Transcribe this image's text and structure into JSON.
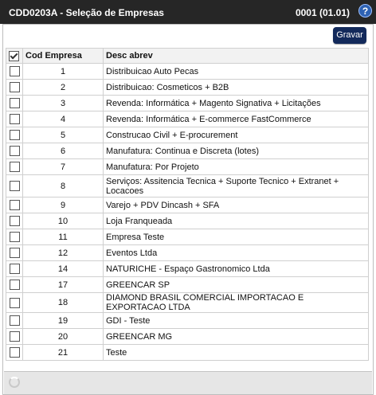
{
  "window": {
    "title": "CDD0203A - Seleção de Empresas",
    "version": "0001 (01.01)",
    "help_label": "?"
  },
  "toolbar": {
    "save_label": "Gravar"
  },
  "grid": {
    "columns": [
      "Cod Empresa",
      "Desc abrev"
    ],
    "rows": [
      {
        "code": "1",
        "desc": "Distribuicao Auto Pecas"
      },
      {
        "code": "2",
        "desc": "Distribuicao: Cosmeticos + B2B"
      },
      {
        "code": "3",
        "desc": "Revenda: Informática + Magento Signativa + Licitações"
      },
      {
        "code": "4",
        "desc": "Revenda: Informática + E-commerce FastCommerce"
      },
      {
        "code": "5",
        "desc": "Construcao Civil + E-procurement"
      },
      {
        "code": "6",
        "desc": "Manufatura: Continua e Discreta (lotes)"
      },
      {
        "code": "7",
        "desc": "Manufatura: Por Projeto"
      },
      {
        "code": "8",
        "desc": "Serviços: Assitencia Tecnica + Suporte Tecnico + Extranet + Locacoes"
      },
      {
        "code": "9",
        "desc": "Varejo + PDV Dincash + SFA"
      },
      {
        "code": "10",
        "desc": "Loja Franqueada"
      },
      {
        "code": "11",
        "desc": "Empresa Teste"
      },
      {
        "code": "12",
        "desc": "Eventos Ltda"
      },
      {
        "code": "14",
        "desc": "NATURICHE - Espaço Gastronomico Ltda"
      },
      {
        "code": "17",
        "desc": "GREENCAR SP"
      },
      {
        "code": "18",
        "desc": "DIAMOND BRASIL COMERCIAL IMPORTACAO E EXPORTACAO LTDA"
      },
      {
        "code": "19",
        "desc": "GDI - Teste"
      },
      {
        "code": "20",
        "desc": "GREENCAR MG"
      },
      {
        "code": "21",
        "desc": "Teste"
      }
    ]
  },
  "colors": {
    "titlebar": "#262626",
    "button": "#132a5b",
    "help": "#2e62b3"
  }
}
